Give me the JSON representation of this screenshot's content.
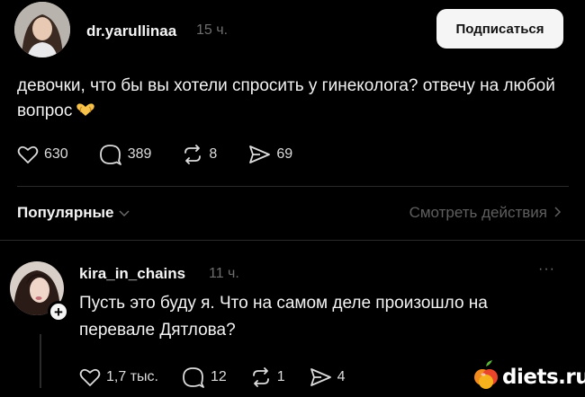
{
  "post": {
    "username": "dr.yarullinaa",
    "time": "15 ч.",
    "follow_label": "Подписаться",
    "text": "девочки, что бы вы хотели спросить у гинеколога? отвечу на любой вопрос",
    "stats": {
      "likes": "630",
      "comments": "389",
      "reposts": "8",
      "shares": "69"
    }
  },
  "sort_bar": {
    "label": "Популярные",
    "view_activity": "Смотреть действия"
  },
  "reply": {
    "username": "kira_in_chains",
    "time": "11 ч.",
    "text": "Пусть это буду я. Что на самом деле произошло на перевале Дятлова?",
    "stats": {
      "likes": "1,7 тыс.",
      "comments": "12",
      "reposts": "1",
      "shares": "4"
    },
    "more_label": "···"
  },
  "watermark": {
    "text": "diets.ru"
  },
  "icons": [
    "heart-icon",
    "comment-icon",
    "repost-icon",
    "share-icon",
    "chevron-down-icon",
    "chevron-right-icon",
    "plus-icon",
    "more-icon",
    "heart-hands-emoji",
    "fruit-logo"
  ]
}
